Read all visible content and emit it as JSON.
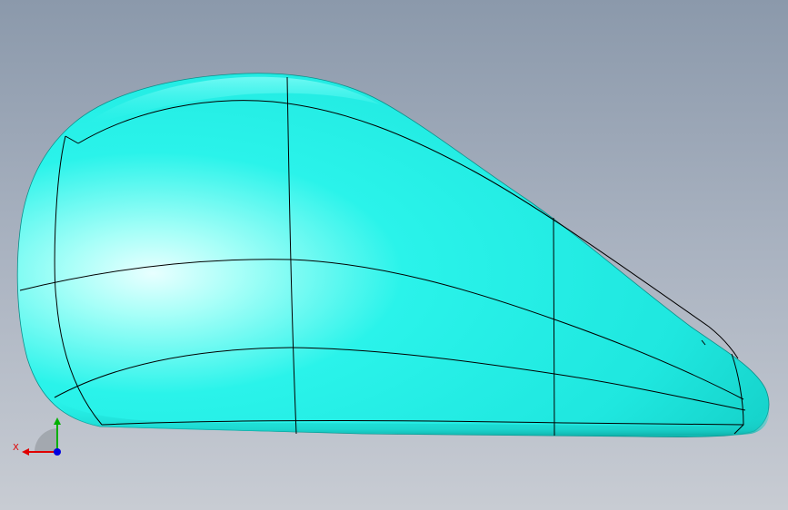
{
  "viewport": {
    "background_top": "#8b99ab",
    "background_bottom": "#c8ccd3"
  },
  "model": {
    "name": "surface-body",
    "fill_color": "#00fff0",
    "edge_color": "#000000"
  },
  "triad": {
    "x_label": "X",
    "x_color": "#e00000",
    "y_color": "#00b000",
    "z_color": "#0000e0"
  }
}
